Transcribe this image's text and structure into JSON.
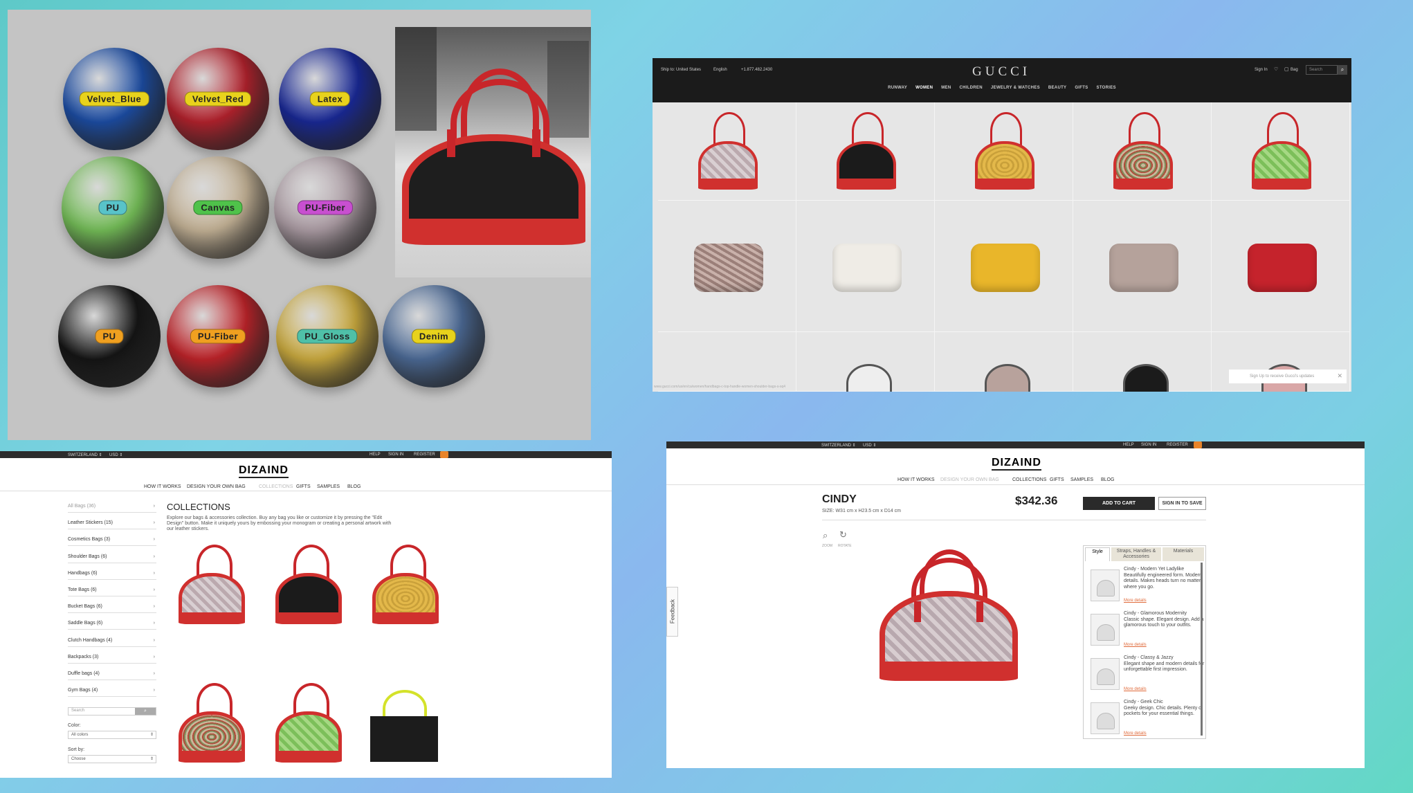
{
  "materials": {
    "spheres": [
      {
        "label": "Velvet_Blue",
        "color": "#1d4fa8",
        "tag": "#e8d21c"
      },
      {
        "label": "Velvet_Red",
        "color": "#b8232e",
        "tag": "#e8d21c"
      },
      {
        "label": "Latex",
        "color": "#1a2a9a",
        "tag": "#e8d21c"
      },
      {
        "label": "PU",
        "color": "#77c25a",
        "tag": "#58c3c9"
      },
      {
        "label": "Canvas",
        "color": "#c9b79a",
        "tag": "#4fc24a"
      },
      {
        "label": "PU-Fiber",
        "color": "#b0a0a8",
        "tag": "#c84fd0"
      },
      {
        "label": "PU",
        "color": "#161616",
        "tag": "#f0a020"
      },
      {
        "label": "PU-Fiber",
        "color": "#c4252b",
        "tag": "#f0a020"
      },
      {
        "label": "PU_Gloss",
        "color": "#cfae40",
        "tag": "#4fc0a8"
      },
      {
        "label": "Denim",
        "color": "#4e6d9a",
        "tag": "#e8d21c"
      }
    ]
  },
  "gucci": {
    "ship_to": "Ship to: United States",
    "language": "English",
    "phone": "+1.877.482.2430",
    "logo": "GUCCI",
    "sign_in": "Sign In",
    "bag": "Bag",
    "search_placeholder": "Search",
    "nav": [
      "RUNWAY",
      "WOMEN",
      "MEN",
      "CHILDREN",
      "JEWELRY & WATCHES",
      "BEAUTY",
      "GIFTS",
      "STORIES"
    ],
    "signup": "Sign Up to receive Gucci's updates",
    "status_url": "www.gucci.com/us/en/ca/women/handbags-c-top-handle-women-shoulder-bags-s-sq4"
  },
  "collections": {
    "region": "SWITZERLAND",
    "currency": "USD",
    "help": "HELP",
    "sign_in": "SIGN IN",
    "register": "REGISTER",
    "logo": "DIZAIND",
    "nav": [
      "HOW IT WORKS",
      "DESIGN YOUR OWN BAG",
      "COLLECTIONS",
      "GIFTS",
      "SAMPLES",
      "BLOG"
    ],
    "title": "COLLECTIONS",
    "intro": "Explore our bags & accessories collection. Buy any bag you like or customize it by pressing the \"Edit Design\" button. Make it uniquely yours by embossing your monogram or creating a personal artwork with our leather stickers.",
    "categories": [
      "All Bags (36)",
      "Leather Stickers (15)",
      "Cosmetics Bags (3)",
      "Shoulder Bags (6)",
      "Handbags (6)",
      "Tote Bags (6)",
      "Bucket Bags (6)",
      "Saddle Bags (6)",
      "Clutch Handbags (4)",
      "Backpacks (3)",
      "Duffle bags (4)",
      "Gym Bags (4)"
    ],
    "search_placeholder": "Search",
    "color_label": "Color:",
    "color_value": "All colors",
    "sort_label": "Sort by:",
    "sort_value": "Choose"
  },
  "product": {
    "region": "SWITZERLAND",
    "currency": "USD",
    "help": "HELP",
    "sign_in": "SIGN IN",
    "register": "REGISTER",
    "logo": "DIZAIND",
    "nav": [
      "HOW IT WORKS",
      "DESIGN YOUR OWN BAG",
      "COLLECTIONS",
      "GIFTS",
      "SAMPLES",
      "BLOG"
    ],
    "name": "CINDY",
    "size": "SIZE: W31 cm x H23.5 cm x D14 cm",
    "price": "$342.36",
    "add_to_cart": "ADD TO CART",
    "sign_in_to_save": "SIGN IN TO SAVE",
    "zoom": "ZOOM",
    "rotate": "ROTATE",
    "feedback": "Feedback",
    "tabs": [
      "Style",
      "Straps, Handles & Accessories",
      "Materials"
    ],
    "styles": [
      {
        "title": "Cindy - Modern Yet Ladylike",
        "desc": "Beautifully engineered form. Modern details. Makes heads turn no matter where you go.",
        "more": "More details"
      },
      {
        "title": "Cindy - Glamorous Modernity",
        "desc": "Classic shape. Elegant design. Add a glamorous touch to your outfits.",
        "more": "More details"
      },
      {
        "title": "Cindy - Classy & Jazzy",
        "desc": "Elegant shape and modern details for unforgettable first impression.",
        "more": "More details"
      },
      {
        "title": "Cindy - Geek Chic",
        "desc": "Geeky design. Chic details. Plenty of pockets for your essential things.",
        "more": "More details"
      }
    ]
  }
}
